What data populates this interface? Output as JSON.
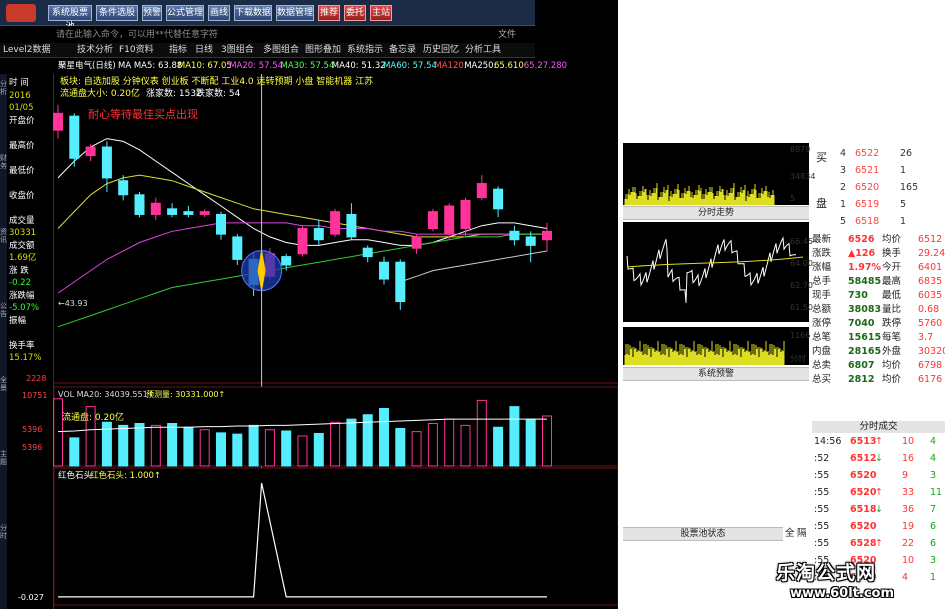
{
  "toolbar": {
    "buttons": [
      "系统股票池",
      "条件选股",
      "预警",
      "公式管理",
      "画线",
      "下载数据",
      "数据管理",
      "推荐",
      "委托",
      "主站"
    ],
    "colors": [
      "blue",
      "blue",
      "blue",
      "blue",
      "blue",
      "blue",
      "blue",
      "red",
      "red",
      "red"
    ]
  },
  "command": {
    "placeholder": "请在此输入命令，可以用**代替任意字符",
    "right_mark": "文件"
  },
  "tabs": [
    "Level2数据",
    "技术分析",
    "F10资料",
    "指标",
    "日线",
    "3图组合",
    "多图组合",
    "图形叠加",
    "系统指示",
    "备忘录",
    "历史回忆",
    "分析工具"
  ],
  "quote_line": {
    "name": "聚星电气(日线)",
    "ma": [
      "MA MA5: 63.88",
      "MA10: 67.05",
      "MA20: 57.54",
      "MA30: 57.54",
      "MA40: 51.32",
      "MA60: 57.54",
      "MA120:",
      "MA250:",
      "65.610",
      "65.27.280"
    ],
    "ma_colors": [
      "#ffffff",
      "#ffff55",
      "#ff55ff",
      "#55ff55",
      "#ffffff",
      "#55ffff",
      "#ff5555",
      "#ffffff",
      "#ffff55",
      "#ff55ff"
    ]
  },
  "info": {
    "line1": "板块: 自选加股 分钟仪表 创业板 不断配 工业4.0 远转预期 小盘 智能机器 江苏",
    "line2_a": "流通盘大小: 0.20亿",
    "line2_b": "涨家数: 1532",
    "line2_c": "跌家数: 54"
  },
  "annotation": "耐心等待最佳买点出现",
  "price_label": "←43.93",
  "left_panel": [
    {
      "label": "时 间",
      "color": "#ffffff"
    },
    {
      "label": "2016",
      "color": "#dddd00"
    },
    {
      "label": "01/05",
      "color": "#dddd00"
    },
    {
      "label": "开盘价",
      "color": "#ffffff"
    },
    {
      "label": "",
      "color": "#ff3333"
    },
    {
      "label": "最高价",
      "color": "#ffffff"
    },
    {
      "label": "",
      "color": "#ff3333"
    },
    {
      "label": "最低价",
      "color": "#ffffff"
    },
    {
      "label": "",
      "color": "#ff3333"
    },
    {
      "label": "收盘价",
      "color": "#ffffff"
    },
    {
      "label": "",
      "color": "#ff3333"
    },
    {
      "label": "成交量",
      "color": "#ffffff"
    },
    {
      "label": "30331",
      "color": "#dddd00"
    },
    {
      "label": "成交额",
      "color": "#ffffff"
    },
    {
      "label": "1.69亿",
      "color": "#dddd00"
    },
    {
      "label": "涨 跌",
      "color": "#ffffff"
    },
    {
      "label": "-0.22",
      "color": "#33ff33"
    },
    {
      "label": "涨跌幅",
      "color": "#ffffff"
    },
    {
      "label": "-5.07%",
      "color": "#33ff33"
    },
    {
      "label": "振幅",
      "color": "#ffffff"
    },
    {
      "label": "",
      "color": "#ff3333"
    },
    {
      "label": "换手率",
      "color": "#ffffff"
    },
    {
      "label": "15.17%",
      "color": "#dddd00"
    }
  ],
  "vtabs": [
    "分析",
    "财务",
    "资讯",
    "公告",
    "全景",
    "主题",
    "分时"
  ],
  "price_axis": {
    "bottom": "2228"
  },
  "volume": {
    "header_a": "VOL MA20: 34039.551↑",
    "header_b": "预测量: 30331.000↑",
    "float": "流通盘: 0.20亿",
    "axis": [
      "10751",
      "5396",
      "5396"
    ]
  },
  "indicator": {
    "header_a": "红色石头",
    "header_b": "红色石头: 1.000↑",
    "axis_bottom": "-0.027"
  },
  "chart_data": [
    {
      "type": "candlestick",
      "title": "聚星电气(日线)",
      "candles": [
        {
          "o": 85.0,
          "c": 88.0,
          "h": 89.5,
          "l": 83.5
        },
        {
          "o": 87.5,
          "c": 80.0,
          "h": 88.0,
          "l": 78.5
        },
        {
          "o": 80.5,
          "c": 82.0,
          "h": 82.5,
          "l": 79.5
        },
        {
          "o": 82.0,
          "c": 76.5,
          "h": 83.0,
          "l": 74.0
        },
        {
          "o": 76.0,
          "c": 73.5,
          "h": 77.0,
          "l": 72.5
        },
        {
          "o": 73.5,
          "c": 70.0,
          "h": 74.0,
          "l": 69.5
        },
        {
          "o": 70.0,
          "c": 72.0,
          "h": 73.0,
          "l": 69.0
        },
        {
          "o": 71.0,
          "c": 70.0,
          "h": 72.0,
          "l": 69.5
        },
        {
          "o": 70.5,
          "c": 70.0,
          "h": 71.5,
          "l": 69.5
        },
        {
          "o": 70.0,
          "c": 70.5,
          "h": 71.0,
          "l": 69.5
        },
        {
          "o": 70.0,
          "c": 66.5,
          "h": 70.5,
          "l": 65.5
        },
        {
          "o": 66.0,
          "c": 62.0,
          "h": 66.5,
          "l": 61.0
        },
        {
          "o": 62.0,
          "c": 57.5,
          "h": 63.0,
          "l": 55.5
        },
        {
          "o": 59.0,
          "c": 63.0,
          "h": 64.0,
          "l": 58.5
        },
        {
          "o": 62.5,
          "c": 61.0,
          "h": 63.0,
          "l": 60.0
        },
        {
          "o": 63.0,
          "c": 67.5,
          "h": 68.0,
          "l": 62.5
        },
        {
          "o": 67.5,
          "c": 65.5,
          "h": 69.0,
          "l": 64.5
        },
        {
          "o": 66.5,
          "c": 70.5,
          "h": 71.0,
          "l": 66.0
        },
        {
          "o": 70.0,
          "c": 66.0,
          "h": 72.0,
          "l": 65.5
        },
        {
          "o": 64.0,
          "c": 62.5,
          "h": 64.5,
          "l": 61.5
        },
        {
          "o": 61.5,
          "c": 58.5,
          "h": 62.5,
          "l": 57.5
        },
        {
          "o": 61.5,
          "c": 54.5,
          "h": 62.0,
          "l": 53.0
        },
        {
          "o": 64.0,
          "c": 66.0,
          "h": 66.5,
          "l": 63.0
        },
        {
          "o": 67.5,
          "c": 70.5,
          "h": 71.0,
          "l": 67.0
        },
        {
          "o": 66.5,
          "c": 71.5,
          "h": 72.0,
          "l": 65.5
        },
        {
          "o": 67.5,
          "c": 72.5,
          "h": 73.0,
          "l": 66.0
        },
        {
          "o": 73.0,
          "c": 75.5,
          "h": 77.0,
          "l": 72.5
        },
        {
          "o": 74.5,
          "c": 71.0,
          "h": 75.0,
          "l": 69.5
        },
        {
          "o": 67.0,
          "c": 65.5,
          "h": 68.0,
          "l": 64.5
        },
        {
          "o": 66.0,
          "c": 64.5,
          "h": 67.0,
          "l": 61.5
        },
        {
          "o": 65.5,
          "c": 67.0,
          "h": 68.5,
          "l": 63.5
        }
      ],
      "ma_series": [
        {
          "values": [
            76.5,
            79.5,
            82.0,
            83.5,
            83.0,
            81.5,
            79.5,
            77.5,
            75.5,
            73.5,
            71.5,
            69.5,
            67.5,
            66.0,
            65.0,
            64.5,
            64.5,
            65.0,
            65.5,
            65.5,
            65.0,
            64.5,
            64.5,
            65.0,
            66.0,
            67.0,
            68.0,
            68.5,
            68.5,
            68.0,
            67.5
          ],
          "color": "#ffffff"
        },
        {
          "values": [
            67.5,
            70.5,
            73.5,
            75.5,
            76.5,
            77.0,
            76.5,
            76.0,
            75.0,
            74.0,
            73.0,
            72.0,
            71.0,
            70.5,
            70.0,
            69.5,
            69.0,
            68.5,
            68.0,
            67.5,
            67.0,
            66.5,
            66.0,
            66.0,
            66.0,
            66.0,
            66.5,
            66.5,
            66.5,
            66.5,
            66.5
          ],
          "color": "#dddd33"
        },
        {
          "values": [
            56.0,
            58.0,
            60.0,
            62.0,
            63.5,
            65.0,
            66.0,
            67.0,
            67.5,
            68.0,
            68.5,
            68.5,
            68.5,
            68.5,
            68.5,
            68.0,
            68.0,
            67.5,
            67.5,
            67.5,
            67.0,
            67.0,
            66.5,
            66.5,
            66.5,
            66.5,
            66.5,
            66.5,
            66.5,
            66.5,
            66.5
          ],
          "color": "#dd44dd"
        },
        {
          "values": [
            50.0,
            51.0,
            52.0,
            53.0,
            54.0,
            55.0,
            56.0,
            57.0,
            57.5,
            58.0,
            58.5,
            59.0,
            59.5,
            60.0,
            60.5,
            61.0,
            61.5,
            62.0,
            62.5,
            63.0,
            63.5,
            64.0,
            64.5,
            65.0,
            65.5,
            66.0,
            66.0,
            66.0,
            66.5,
            66.5,
            66.5
          ],
          "color": "#33cc33"
        },
        {
          "values": [
            null,
            null,
            null,
            null,
            null,
            null,
            null,
            null,
            null,
            null,
            null,
            null,
            null,
            null,
            null,
            null,
            null,
            null,
            null,
            null,
            null,
            58.0,
            59.0,
            60.0,
            60.5,
            61.0,
            61.5,
            62.0,
            62.5,
            63.0,
            63.5
          ],
          "color": "#cccccc"
        }
      ],
      "ylim": [
        40,
        95
      ]
    },
    {
      "type": "bar",
      "title": "VOL",
      "values": [
        10751,
        4500,
        9500,
        7000,
        6500,
        6800,
        6500,
        6800,
        6200,
        5800,
        5300,
        5100,
        6500,
        5800,
        5600,
        4800,
        5200,
        7000,
        7500,
        8200,
        9200,
        6000,
        5500,
        6800,
        7500,
        6500,
        10500,
        6200,
        9500,
        7500,
        8000
      ],
      "ma": [
        5500,
        5600,
        5800,
        5900,
        6000,
        6100,
        6200,
        6200,
        6200,
        6300,
        6300,
        6400,
        6400,
        6500,
        6500,
        6600,
        6700,
        6800,
        6900,
        7000,
        7100,
        7200,
        7300,
        7400,
        7500,
        7500,
        7500,
        7500,
        7500,
        7500,
        7500
      ],
      "ylim": [
        0,
        12000
      ]
    },
    {
      "type": "line",
      "title": "红色石头",
      "values": [
        0,
        0,
        0,
        0,
        0,
        0,
        0,
        0,
        0,
        0,
        0,
        0,
        0,
        1,
        0,
        0,
        0,
        0,
        0,
        0,
        0,
        0,
        0,
        0,
        0,
        0,
        0,
        0,
        0,
        0,
        0
      ],
      "ylim": [
        -0.027,
        1.0
      ]
    }
  ],
  "right": {
    "order_book": [
      {
        "lvl": "4",
        "price": "6522",
        "vol": "26",
        "pc": "#ff4444"
      },
      {
        "lvl": "3",
        "price": "6521",
        "vol": "1",
        "pc": "#ff4444"
      },
      {
        "lvl": "2",
        "price": "6520",
        "vol": "165",
        "pc": "#ff4444"
      },
      {
        "lvl": "1",
        "price": "6519",
        "vol": "5",
        "pc": "#ff4444"
      },
      {
        "lvl": "5",
        "price": "6518",
        "vol": "1",
        "pc": "#ff4444"
      }
    ],
    "buy_label": "买",
    "sell_label": "盘",
    "mini1_label": "分时走势",
    "mini1_axis": [
      "8879",
      "34834",
      "5"
    ],
    "mini2_axis": [
      "66.45",
      "64.00",
      "62.70",
      "61.50"
    ],
    "mini3_label": "系统预警",
    "mini3_axis": [
      "1166",
      "分时"
    ],
    "stats": [
      {
        "k": "最新",
        "v": "6526",
        "k2": "均价",
        "v2": "6512"
      },
      {
        "k": "涨跌",
        "v": "▲126",
        "k2": "换手",
        "v2": "29.24%"
      },
      {
        "k": "涨幅",
        "v": "1.97%",
        "k2": "今开",
        "v2": "6401"
      },
      {
        "k": "总手",
        "v": "58485",
        "k2": "最高",
        "v2": "6835"
      },
      {
        "k": "现手",
        "v": "730",
        "k2": "最低",
        "v2": "6035"
      },
      {
        "k": "总额",
        "v": "38083",
        "k2": "量比",
        "v2": "0.68"
      },
      {
        "k": "涨停",
        "v": "7040",
        "k2": "跌停",
        "v2": "5760"
      },
      {
        "k": "总笔",
        "v": "15615",
        "k2": "每笔",
        "v2": "3.7"
      },
      {
        "k": "内盘",
        "v": "28165",
        "k2": "外盘",
        "v2": "30320"
      },
      {
        "k": "总卖",
        "v": "6807",
        "k2": "均价",
        "v2": "6798"
      },
      {
        "k": "总买",
        "v": "2812",
        "k2": "均价",
        "v2": "6176"
      }
    ],
    "ticks_header": "分时成交",
    "ticks": [
      {
        "t": "14:56",
        "p": "6513",
        "a": "↑",
        "v": "10",
        "n": "4"
      },
      {
        "t": ":52",
        "p": "6512",
        "a": "↓",
        "v": "16",
        "n": "4"
      },
      {
        "t": ":55",
        "p": "6520",
        "a": "",
        "v": "9",
        "n": "3"
      },
      {
        "t": ":55",
        "p": "6520",
        "a": "↑",
        "v": "33",
        "n": "11"
      },
      {
        "t": ":55",
        "p": "6518",
        "a": "↓",
        "v": "36",
        "n": "7"
      },
      {
        "t": ":55",
        "p": "6520",
        "a": "",
        "v": "19",
        "n": "6"
      },
      {
        "t": ":55",
        "p": "6528",
        "a": "↑",
        "v": "22",
        "n": "6"
      },
      {
        "t": ":55",
        "p": "6520",
        "a": "",
        "v": "10",
        "n": "3"
      },
      {
        "t": ":55",
        "p": "6520",
        "a": "",
        "v": "4",
        "n": "1"
      }
    ],
    "status_bar": "股票池状态",
    "status_btns": [
      "全",
      "隔"
    ]
  },
  "watermark": {
    "line1": "乐淘公式网",
    "line2": "www.60lt.com"
  }
}
